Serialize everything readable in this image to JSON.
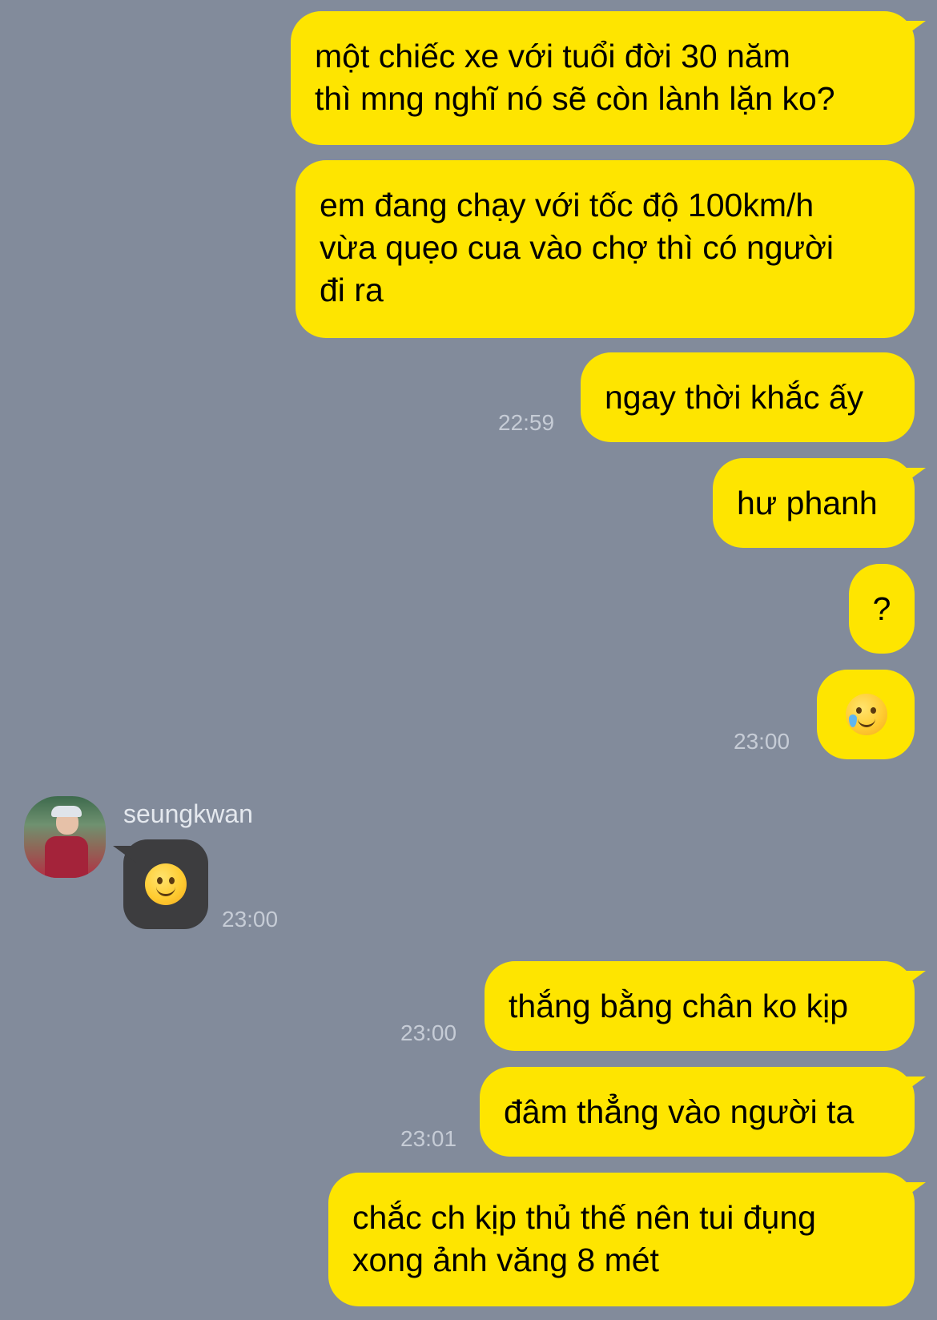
{
  "chat": {
    "messages": [
      {
        "lines": [
          "một chiếc xe với tuổi đời 30 năm",
          "thì mng nghĩ nó sẽ còn lành lặn ko?"
        ]
      },
      {
        "lines": [
          "em đang chạy với tốc độ 100km/h",
          "vừa quẹo cua vào chợ thì có người",
          "đi ra"
        ]
      },
      {
        "lines": [
          "ngay thời khắc ấy"
        ],
        "time": "22:59"
      },
      {
        "lines": [
          "hư phanh"
        ]
      },
      {
        "lines": [
          "?"
        ]
      },
      {
        "emoji": "crying-smile-emoji",
        "time": "23:00"
      },
      {
        "sender": "seungkwan",
        "emoji": "slight-smile-emoji",
        "time": "23:00"
      },
      {
        "lines": [
          "thắng bằng chân ko kịp"
        ],
        "time": "23:00"
      },
      {
        "lines": [
          "đâm thẳng vào người ta"
        ],
        "time": "23:01"
      },
      {
        "lines": [
          "chắc ch kịp thủ thế nên tui đụng",
          "xong ảnh văng 8 mét"
        ]
      }
    ]
  },
  "colors": {
    "background": "#828b9b",
    "outgoing_bubble": "#fee500",
    "incoming_bubble": "#3d3d3f",
    "timestamp": "#c6ccd6"
  }
}
